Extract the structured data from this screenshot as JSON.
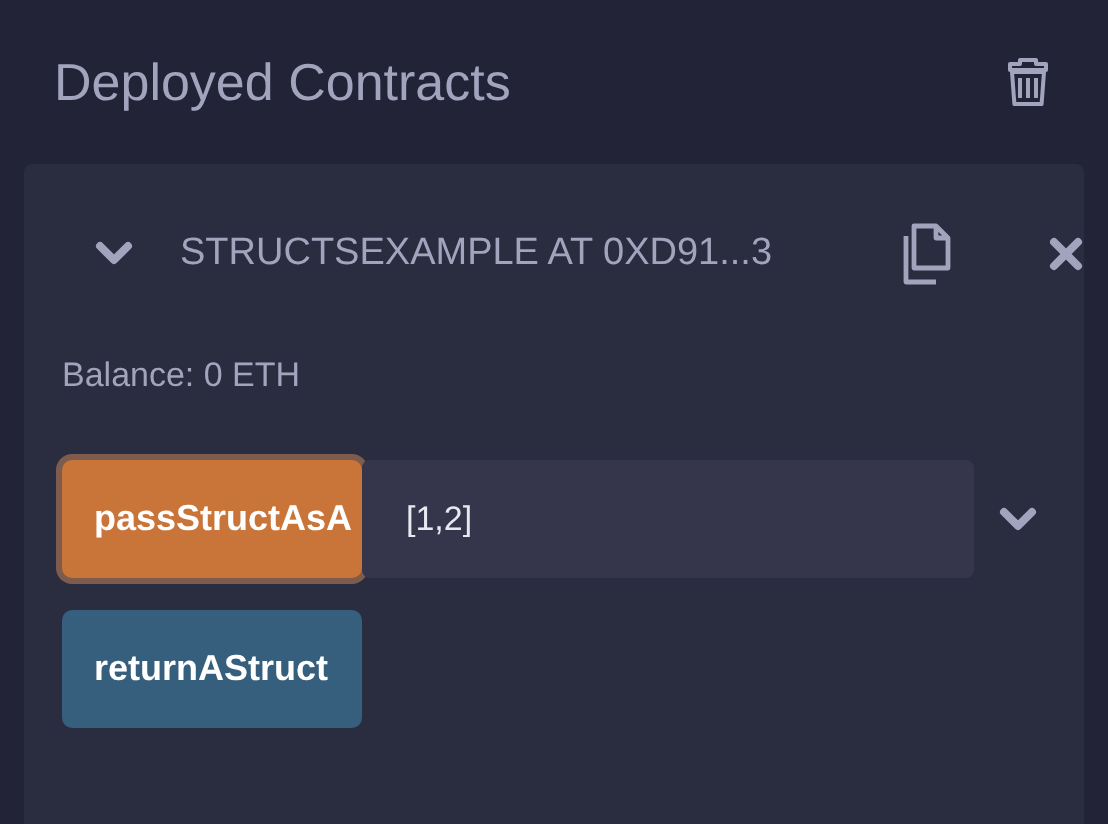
{
  "section": {
    "title": "Deployed Contracts"
  },
  "contract": {
    "name": "STRUCTSEXAMPLE AT 0XD91...3",
    "expanded": true,
    "balance": "Balance: 0 ETH",
    "functions": [
      {
        "kind": "transact",
        "label": "passStructAsA",
        "focused": true,
        "value": "[1,2]"
      },
      {
        "kind": "call",
        "label": "returnAStruct",
        "focused": false
      }
    ]
  }
}
